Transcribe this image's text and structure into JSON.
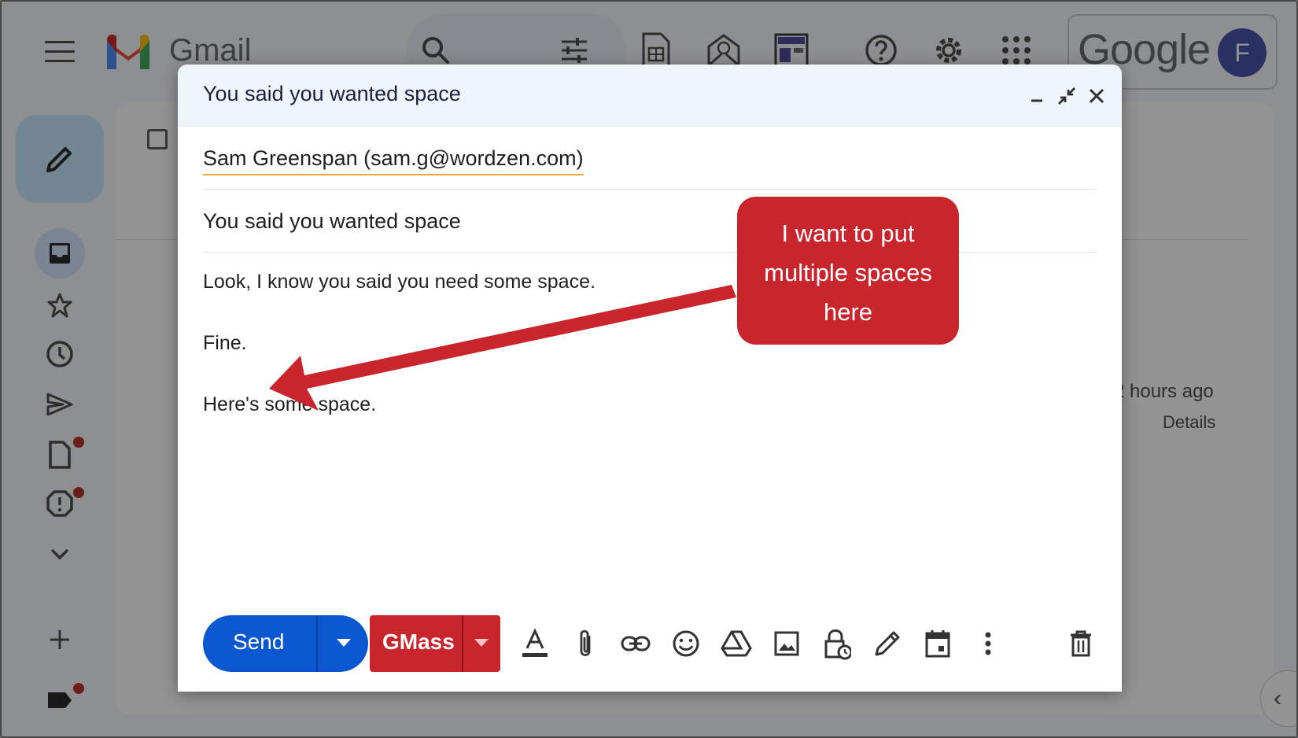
{
  "app": {
    "brand": "Gmail",
    "account_brand": "Google",
    "avatar_initial": "F"
  },
  "background": {
    "meta_time": "2 hours ago",
    "meta_details": "Details"
  },
  "compose": {
    "title": "You said you wanted space",
    "to": "Sam Greenspan (sam.g@wordzen.com)",
    "subject": "You said you wanted space",
    "body_lines": [
      "Look, I know you said you need some space.",
      "Fine.",
      "Here's some space."
    ],
    "send_label": "Send",
    "gmass_label": "GMass"
  },
  "annotation": {
    "callout_lines": [
      "I want to put",
      "multiple spaces",
      "here"
    ],
    "color": "#c9252c"
  },
  "colors": {
    "send_blue": "#0b57d0",
    "gmass_red": "#c9252c",
    "header_bg": "#f0f4fb"
  },
  "icons": {
    "toolbar": [
      "text-format-icon",
      "attach-icon",
      "link-icon",
      "emoji-icon",
      "drive-icon",
      "image-icon",
      "confidential-lock-icon",
      "signature-pen-icon",
      "schedule-calendar-icon",
      "more-options-icon",
      "discard-trash-icon"
    ]
  }
}
